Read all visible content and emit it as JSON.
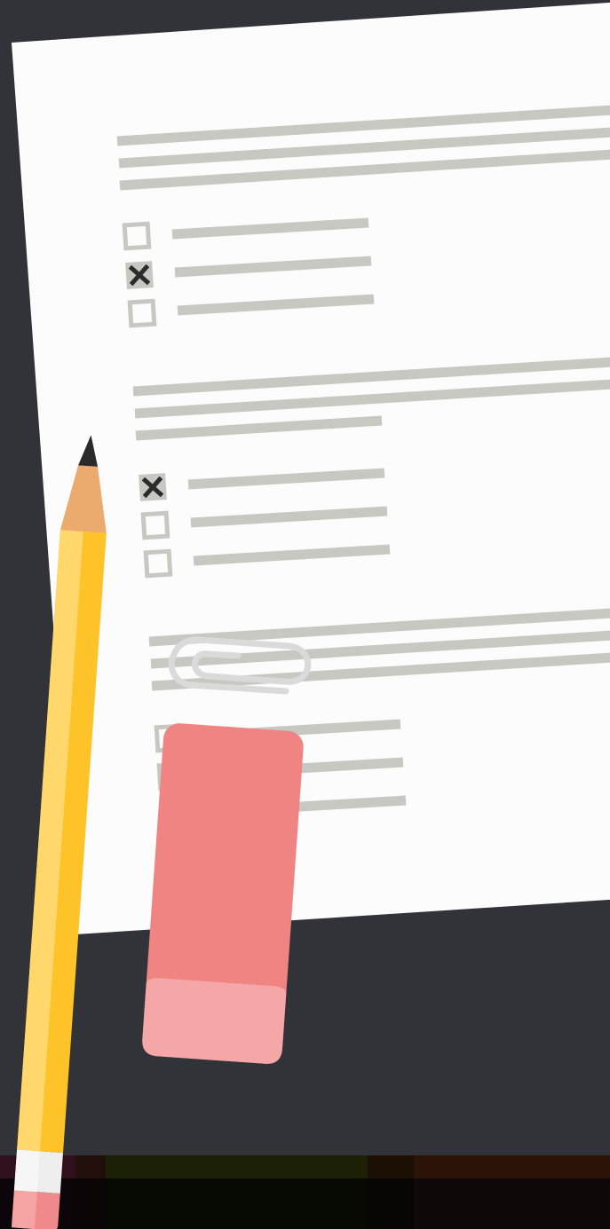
{
  "scene": {
    "background_color": "#323338",
    "paper_color": "#fcfcfc",
    "line_color": "#c8c8c3",
    "checkbox_color": "#c8c8c3",
    "mark_color": "#2b2b2b"
  },
  "questions": [
    {
      "options": [
        {
          "checked": false
        },
        {
          "checked": true
        },
        {
          "checked": false
        }
      ]
    },
    {
      "options": [
        {
          "checked": true
        },
        {
          "checked": false
        },
        {
          "checked": false
        }
      ]
    },
    {
      "options": [
        {
          "checked": false
        },
        {
          "checked": false
        },
        {
          "checked": false
        }
      ]
    }
  ],
  "objects": {
    "pencil": {
      "body_color": "#ffc32a",
      "highlight_color": "#ffd76a",
      "wood_color": "#ebaa6e",
      "lead_color": "#2a2a2a",
      "ferrule_color": "#eeeeee",
      "eraser_color": "#f08a8a"
    },
    "eraser": {
      "color": "#f08482",
      "sleeve_color": "#f5a7a7"
    },
    "paperclip": {
      "color": "#dadada"
    }
  },
  "bottom_band": {
    "colors": [
      "#31101d",
      "#201009",
      "#1c2106",
      "#1b1003",
      "#2d1207"
    ]
  }
}
